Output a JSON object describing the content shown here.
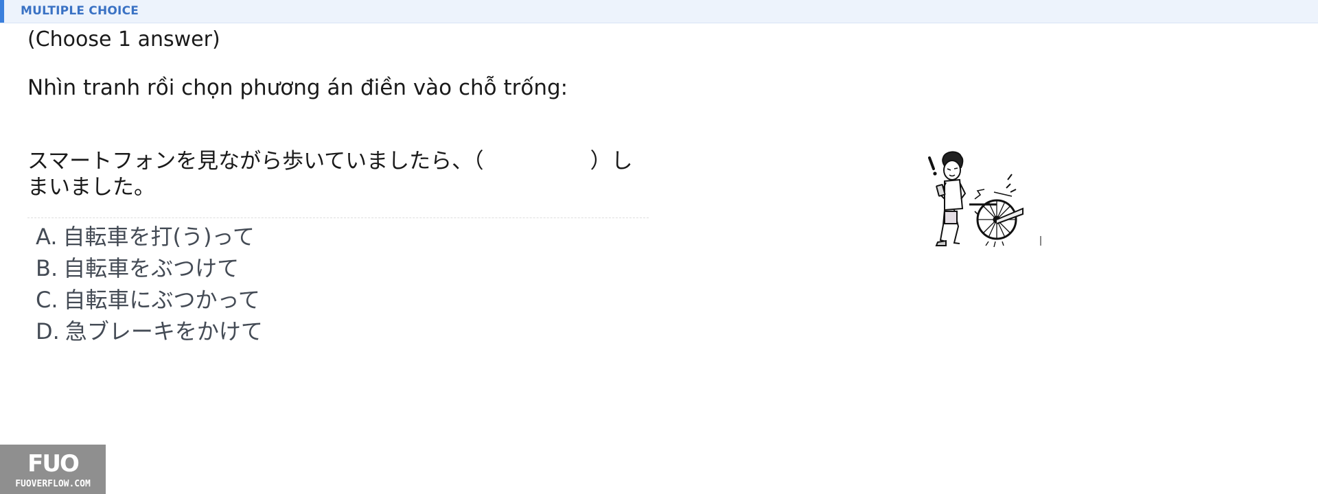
{
  "header": {
    "label": "MULTIPLE CHOICE",
    "accent_color": "#3b7fdc"
  },
  "question": {
    "instruction": "(Choose 1 answer)",
    "prompt": "Nhìn tranh rồi chọn phương án điền vào chỗ trống:",
    "sentence": "スマートフォンを見ながら歩いていましたら、（　　　　　）しまいました。"
  },
  "options": [
    {
      "letter": "A.",
      "text": "自転車を打(う)って"
    },
    {
      "letter": "B.",
      "text": "自転車をぶつけて"
    },
    {
      "letter": "C.",
      "text": "自転車にぶつかって"
    },
    {
      "letter": "D.",
      "text": "急ブレーキをかけて"
    }
  ],
  "illustration": {
    "icon": "man-with-phone-bumping-bicycle-illustration"
  },
  "watermark": {
    "logo": "FUO",
    "site": "FUOVERFLOW.COM"
  }
}
